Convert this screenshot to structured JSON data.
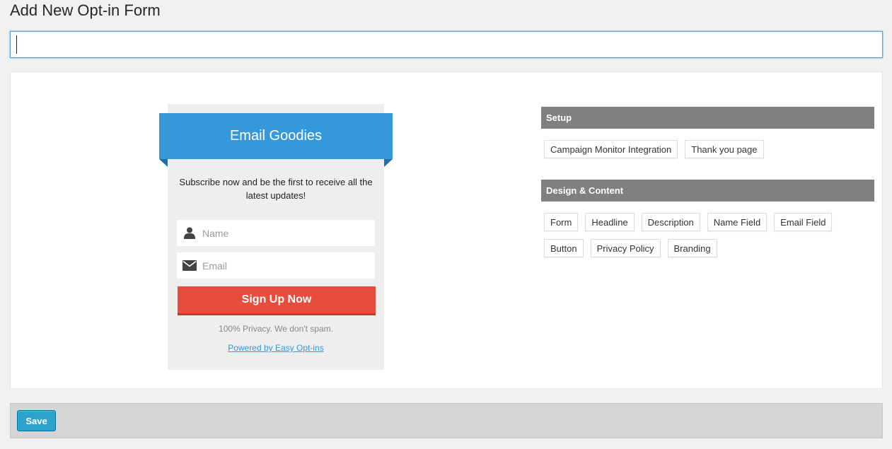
{
  "page": {
    "title": "Add New Opt-in Form",
    "title_input_value": ""
  },
  "preview": {
    "headline": "Email Goodies",
    "description": "Subscribe now and be the first to receive all the latest updates!",
    "name_placeholder": "Name",
    "email_placeholder": "Email",
    "button_label": "Sign Up Now",
    "privacy_text": "100% Privacy. We don't spam.",
    "powered_by": "Powered by Easy Opt-ins",
    "colors": {
      "ribbon": "#3498db",
      "button": "#e74c3c",
      "form_bg": "#eeeeee"
    },
    "icons": [
      "user-icon",
      "envelope-icon"
    ]
  },
  "setup": {
    "heading": "Setup",
    "buttons": [
      "Campaign Monitor Integration",
      "Thank you page"
    ]
  },
  "design": {
    "heading": "Design & Content",
    "row1": [
      "Form",
      "Headline",
      "Description",
      "Name Field",
      "Email Field"
    ],
    "row2": [
      "Button",
      "Privacy Policy",
      "Branding"
    ]
  },
  "footer": {
    "save_label": "Save"
  }
}
